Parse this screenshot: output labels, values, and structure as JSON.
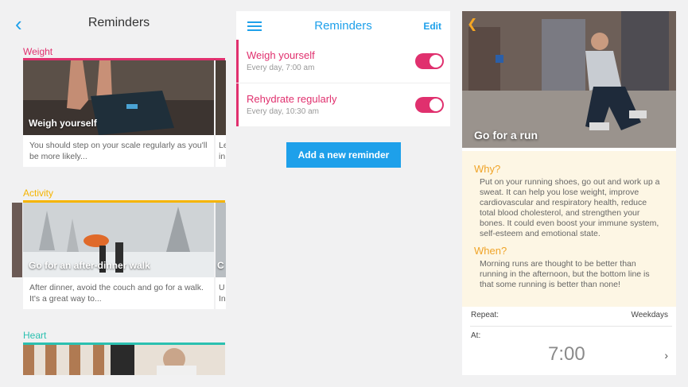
{
  "panel1": {
    "title": "Reminders",
    "sections": [
      {
        "label": "Weight",
        "color": "#e0306e",
        "card_title": "Weigh yourself",
        "card_desc": "You should step on your scale regularly as you'll be more likely...",
        "peek_desc": "Le in"
      },
      {
        "label": "Activity",
        "color": "#f5b400",
        "card_title": "Go for an after-dinner walk",
        "card_desc": "After dinner, avoid the couch and go for a walk. It's a great way to...",
        "peek_desc": "U In",
        "peek_title": "C"
      },
      {
        "label": "Heart",
        "color": "#2bc0b0"
      }
    ]
  },
  "panel2": {
    "title": "Reminders",
    "edit_label": "Edit",
    "reminders": [
      {
        "title": "Weigh yourself",
        "schedule": "Every day, 7:00 am",
        "enabled": true
      },
      {
        "title": "Rehydrate regularly",
        "schedule": "Every day, 10:30 am",
        "enabled": true
      }
    ],
    "add_button_label": "Add a new reminder"
  },
  "panel3": {
    "hero_title": "Go for a run",
    "why_heading": "Why?",
    "why_text": "Put on your running shoes, go out and work up a sweat. It can help you lose weight, improve cardiovascular and respiratory health, reduce total blood cholesterol, and strengthen your bones. It could even boost your immune system, self-esteem and emotional state.",
    "when_heading": "When?",
    "when_text": "Morning runs are thought to be better than running in the afternoon, but the bottom line is that some running is better than none!",
    "repeat_label": "Repeat:",
    "repeat_value": "Weekdays",
    "at_label": "At:",
    "time_value": "7:00"
  }
}
